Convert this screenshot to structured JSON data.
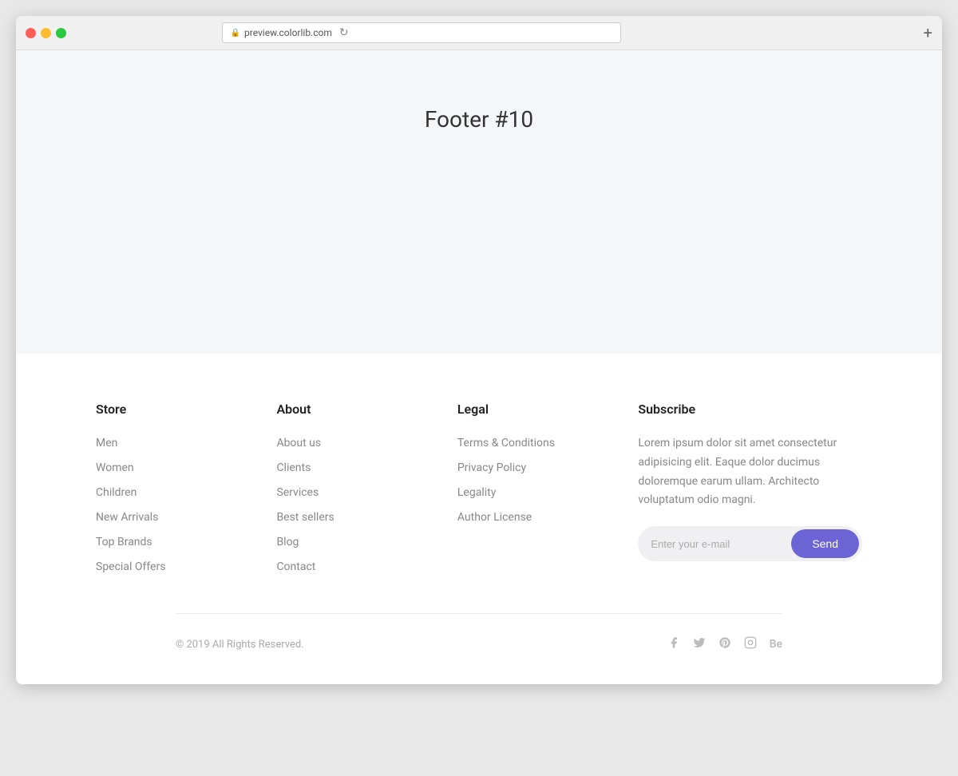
{
  "browser": {
    "url": "preview.colorlib.com",
    "new_tab_label": "+"
  },
  "page": {
    "title": "Footer #10"
  },
  "footer": {
    "store": {
      "heading": "Store",
      "links": [
        "Men",
        "Women",
        "Children",
        "New Arrivals",
        "Top Brands",
        "Special Offers"
      ]
    },
    "about": {
      "heading": "About",
      "links": [
        "About us",
        "Clients",
        "Services",
        "Best sellers",
        "Blog",
        "Contact"
      ]
    },
    "legal": {
      "heading": "Legal",
      "links": [
        "Terms & Conditions",
        "Privacy Policy",
        "Legality",
        "Author License"
      ]
    },
    "subscribe": {
      "heading": "Subscribe",
      "description": "Lorem ipsum dolor sit amet consectetur adipisicing elit. Eaque dolor ducimus doloremque earum ullam. Architecto voluptatum odio magni.",
      "email_placeholder": "Enter your e-mail",
      "send_label": "Send"
    },
    "bottom": {
      "copyright": "© 2019 All Rights Reserved."
    }
  }
}
